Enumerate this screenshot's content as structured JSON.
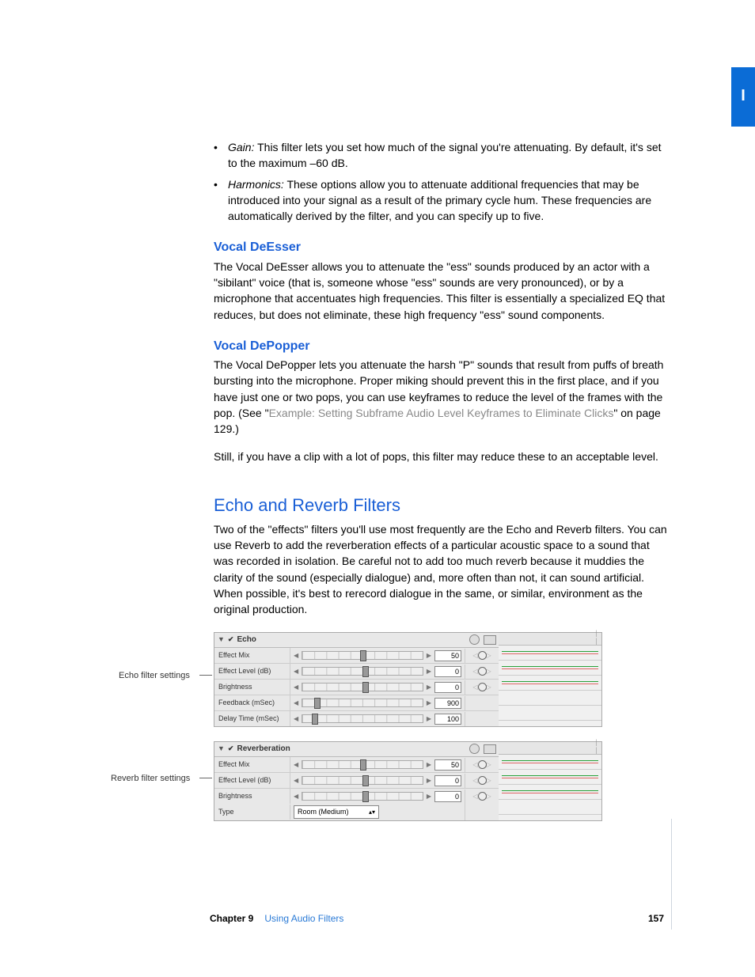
{
  "sidebar_tab": "I",
  "bullets": [
    {
      "term": "Gain:",
      "text": "This filter lets you set how much of the signal you're attenuating. By default, it's set to the maximum –60 dB."
    },
    {
      "term": "Harmonics:",
      "text": "These options allow you to attenuate additional frequencies that may be introduced into your signal as a result of the primary cycle hum. These frequencies are automatically derived by the filter, and you can specify up to five."
    }
  ],
  "deesser": {
    "title": "Vocal DeEsser",
    "body": "The Vocal DeEsser allows you to attenuate the \"ess\" sounds produced by an actor with a \"sibilant\" voice (that is, someone whose \"ess\" sounds are very pronounced), or by a microphone that accentuates high frequencies. This filter is essentially a specialized EQ that reduces, but does not eliminate, these high frequency \"ess\" sound components."
  },
  "depopper": {
    "title": "Vocal DePopper",
    "body1a": "The Vocal DePopper lets you attenuate the harsh \"P\" sounds that result from puffs of breath bursting into the microphone. Proper miking should prevent this in the first place, and if you have just one or two pops, you can use keyframes to reduce the level of the frames with the pop. (See \"",
    "link": "Example:  Setting Subframe Audio Level Keyframes to Eliminate Clicks",
    "body1b": "\" on page 129.)",
    "body2": "Still, if you have a clip with a lot of pops, this filter may reduce these to an acceptable level."
  },
  "echo_reverb": {
    "title": "Echo and Reverb Filters",
    "body": "Two of the \"effects\" filters you'll use most frequently are the Echo and Reverb filters. You can use Reverb to add the reverberation effects of a particular acoustic space to a sound that was recorded in isolation. Be careful not to add too much reverb because it muddies the clarity of the sound (especially dialogue) and, more often than not, it can sound artificial. When possible, it's best to rerecord dialogue in the same, or similar, environment as the original production."
  },
  "fig1": {
    "label": "Echo filter settings",
    "header": "Echo",
    "rows": [
      {
        "label": "Effect Mix",
        "value": "50",
        "thumb": 48,
        "kf": true
      },
      {
        "label": "Effect Level (dB)",
        "value": "0",
        "thumb": 50,
        "kf": true
      },
      {
        "label": "Brightness",
        "value": "0",
        "thumb": 50,
        "kf": true
      },
      {
        "label": "Feedback (mSec)",
        "value": "900",
        "thumb": 10,
        "kf": false
      },
      {
        "label": "Delay Time (mSec)",
        "value": "100",
        "thumb": 8,
        "kf": false
      }
    ]
  },
  "fig2": {
    "label": "Reverb filter settings",
    "header": "Reverberation",
    "rows": [
      {
        "label": "Effect Mix",
        "value": "50",
        "thumb": 48,
        "kf": true
      },
      {
        "label": "Effect Level (dB)",
        "value": "0",
        "thumb": 50,
        "kf": true
      },
      {
        "label": "Brightness",
        "value": "0",
        "thumb": 50,
        "kf": true
      }
    ],
    "type_label": "Type",
    "type_value": "Room (Medium)"
  },
  "footer": {
    "chapter": "Chapter 9",
    "name": "Using Audio Filters",
    "page": "157"
  }
}
